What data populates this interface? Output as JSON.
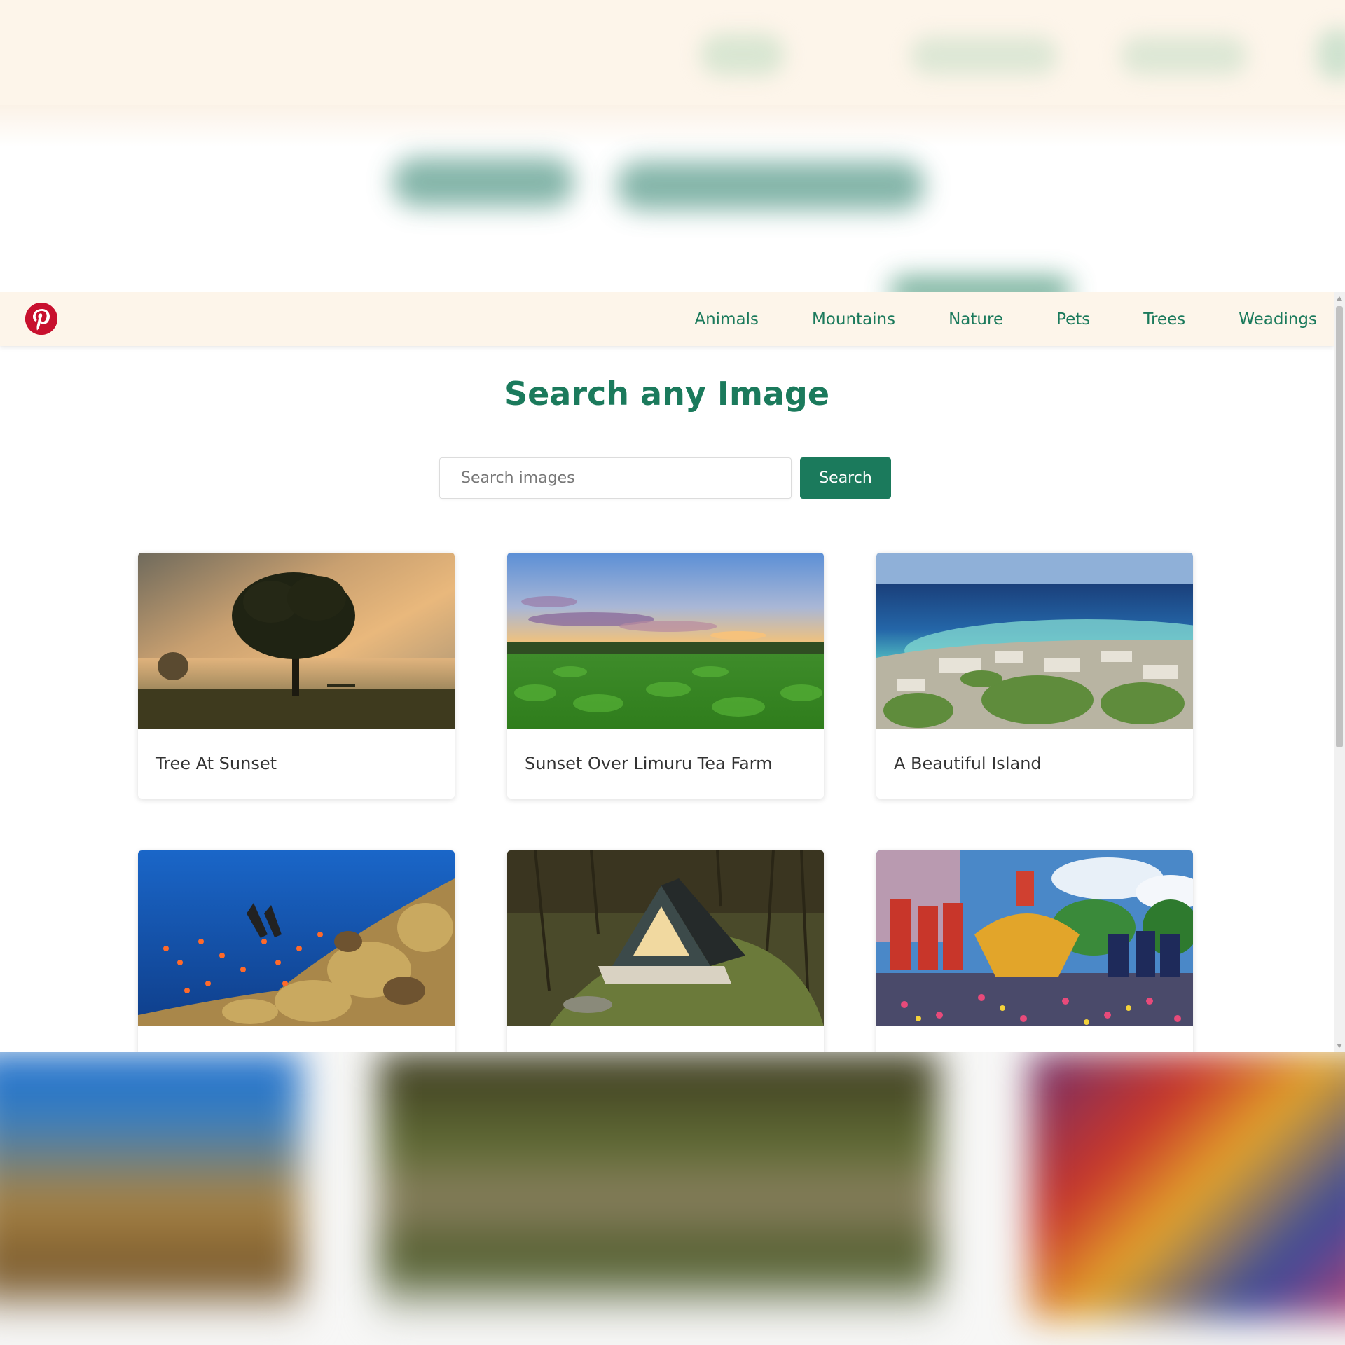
{
  "nav": {
    "logo_icon": "pinterest-logo-icon",
    "links": [
      "Animals",
      "Mountains",
      "Nature",
      "Pets",
      "Trees",
      "Weadings"
    ]
  },
  "main": {
    "title": "Search any Image",
    "search": {
      "placeholder": "Search images",
      "value": "",
      "button_label": "Search"
    }
  },
  "cards": [
    {
      "caption": "Tree At Sunset"
    },
    {
      "caption": "Sunset Over Limuru Tea Farm"
    },
    {
      "caption": "A Beautiful Island"
    },
    {
      "caption": ""
    },
    {
      "caption": ""
    },
    {
      "caption": ""
    }
  ],
  "colors": {
    "accent": "#1b7a5c",
    "nav_bg": "#fdf5ea",
    "logo": "#c8102e"
  }
}
